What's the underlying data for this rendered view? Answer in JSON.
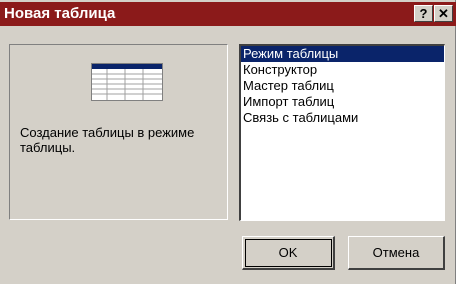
{
  "window": {
    "title": "Новая таблица",
    "help_label": "?",
    "close_label": "✕"
  },
  "preview": {
    "icon": "table-icon",
    "description": "Создание таблицы в режиме таблицы."
  },
  "list": {
    "items": [
      {
        "label": "Режим таблицы",
        "selected": true
      },
      {
        "label": "Конструктор",
        "selected": false
      },
      {
        "label": "Мастер таблиц",
        "selected": false
      },
      {
        "label": "Импорт таблиц",
        "selected": false
      },
      {
        "label": "Связь с таблицами",
        "selected": false
      }
    ]
  },
  "buttons": {
    "ok_label": "OK",
    "cancel_label": "Отмена"
  },
  "colors": {
    "titlebar": "#8b1a1a",
    "selection": "#0a246a",
    "face": "#d4d0c8"
  }
}
